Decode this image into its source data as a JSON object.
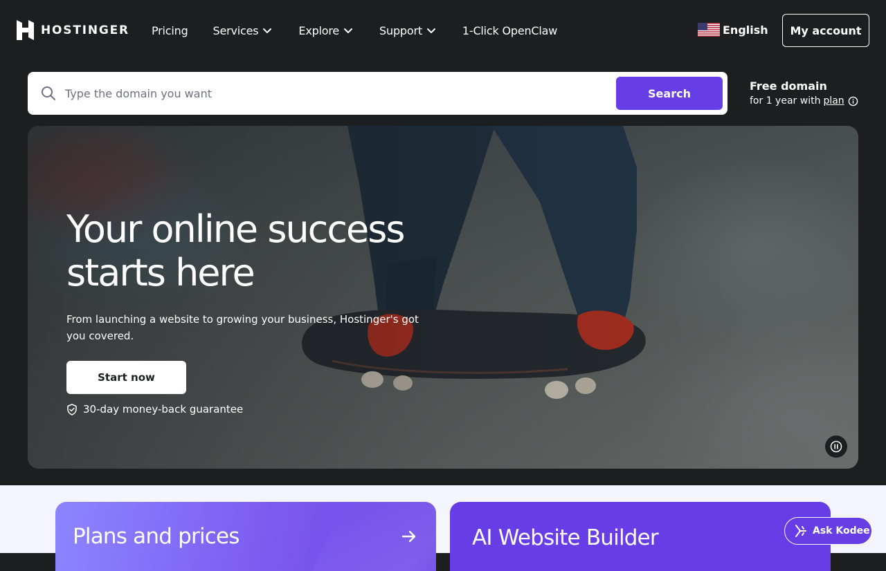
{
  "header": {
    "brand": "HOSTINGER",
    "nav": [
      {
        "label": "Pricing",
        "has_dropdown": false
      },
      {
        "label": "Services",
        "has_dropdown": true
      },
      {
        "label": "Explore",
        "has_dropdown": true
      },
      {
        "label": "Support",
        "has_dropdown": true
      },
      {
        "label": "1-Click OpenClaw",
        "has_dropdown": false
      }
    ],
    "language": "English",
    "language_flag_icon": "us-flag-icon",
    "account_label": "My account"
  },
  "search": {
    "placeholder": "Type the domain you want",
    "value": "",
    "button_label": "Search",
    "icon": "search-icon"
  },
  "free_domain": {
    "title": "Free domain",
    "subtitle": "for 1 year with",
    "link_label": "plan",
    "info_icon": "info-icon"
  },
  "hero": {
    "title_line1": "Your online success",
    "title_line2": "starts here",
    "subtitle": "From launching a website to growing your business, Hostinger's got you covered.",
    "cta_label": "Start now",
    "guarantee": "30-day money-back guarantee",
    "pause_icon": "pause-icon"
  },
  "cards": {
    "plans_title": "Plans and prices",
    "ai_title": "AI Website Builder"
  },
  "chat": {
    "label": "Ask Kodee"
  },
  "colors": {
    "brand_purple": "#673de6",
    "dark_bg": "#1d1e20",
    "light_bg": "#f4f5ff"
  }
}
